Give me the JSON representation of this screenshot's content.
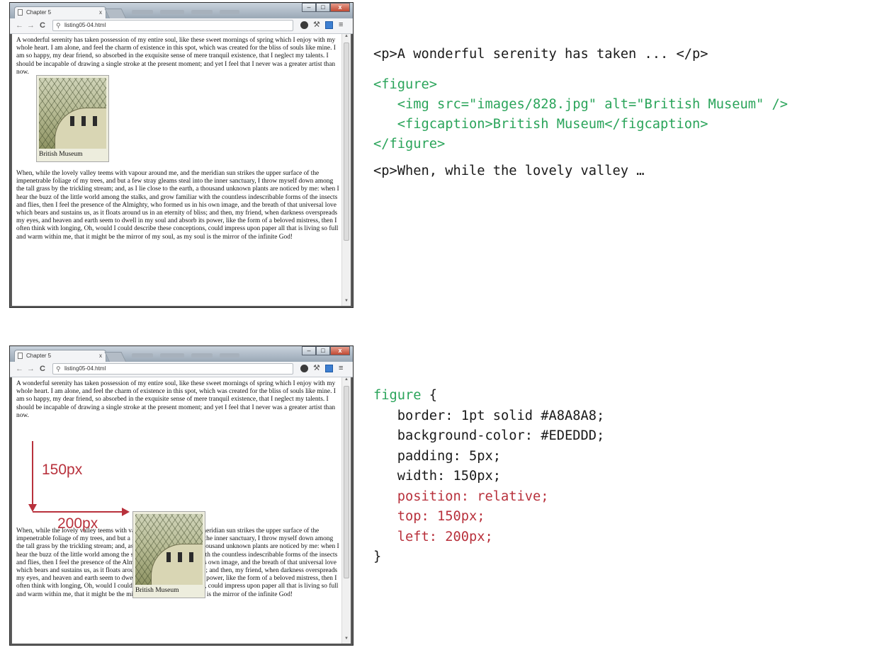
{
  "browser": {
    "tab_title": "Chapter 5",
    "tab_close": "x",
    "address": "listing05-04.html",
    "nav_back": "←",
    "nav_forward": "→",
    "nav_reload": "C",
    "menu_glyph": "≡",
    "wrench_glyph": "⚒",
    "min_glyph": "–",
    "max_glyph": "□",
    "close_glyph": "x"
  },
  "page": {
    "paragraph1": "A wonderful serenity has taken possession of my entire soul, like these sweet mornings of spring which I enjoy with my whole heart. I am alone, and feel the charm of existence in this spot, which was created for the bliss of souls like mine. I am so happy, my dear friend, so absorbed in the exquisite sense of mere tranquil existence, that I neglect my talents. I should be incapable of drawing a single stroke at the present moment; and yet I feel that I never was a greater artist than now.",
    "figcaption": "British Museum",
    "paragraph2": "When, while the lovely valley teems with vapour around me, and the meridian sun strikes the upper surface of the impenetrable foliage of my trees, and but a few stray gleams steal into the inner sanctuary, I throw myself down among the tall grass by the trickling stream; and, as I lie close to the earth, a thousand unknown plants are noticed by me: when I hear the buzz of the little world among the stalks, and grow familiar with the countless indescribable forms of the insects and flies, then I feel the presence of the Almighty, who formed us in his own image, and the breath of that universal love which bears and sustains us, as it floats around us in an eternity of bliss; and then, my friend, when darkness overspreads my eyes, and heaven and earth seem to dwell in my soul and absorb its power, like the form of a beloved mistress, then I often think with longing, Oh, would I could describe these conceptions, could impress upon paper all that is living so full and warm within me, that it might be the mirror of my soul, as my soul is the mirror of the infinite God!"
  },
  "html_code": {
    "line1": "<p>A wonderful serenity has taken ... </p>",
    "line2": "<figure>",
    "line3": "   <img src=\"images/828.jpg\" alt=\"British Museum\" />",
    "line4": "   <figcaption>British Museum</figcaption>",
    "line5": "</figure>",
    "line6": "<p>When, while the lovely valley …"
  },
  "css_code": {
    "selector": "figure",
    "open_brace": " {",
    "border": "   border: 1pt solid #A8A8A8;",
    "background": "   background-color: #EDEDDD;",
    "padding": "   padding: 5px;",
    "width": "   width: 150px;",
    "position": "   position: relative;",
    "top": "   top: 150px;",
    "left": "   left: 200px;",
    "close_brace": "}"
  },
  "annotations": {
    "vertical_label": "150px",
    "horizontal_label": "200px"
  },
  "colors": {
    "html_tag_green": "#2aa45a",
    "css_highlight_red": "#b8313c",
    "figure_border": "#A8A8A8",
    "figure_background": "#EDEDDD"
  }
}
